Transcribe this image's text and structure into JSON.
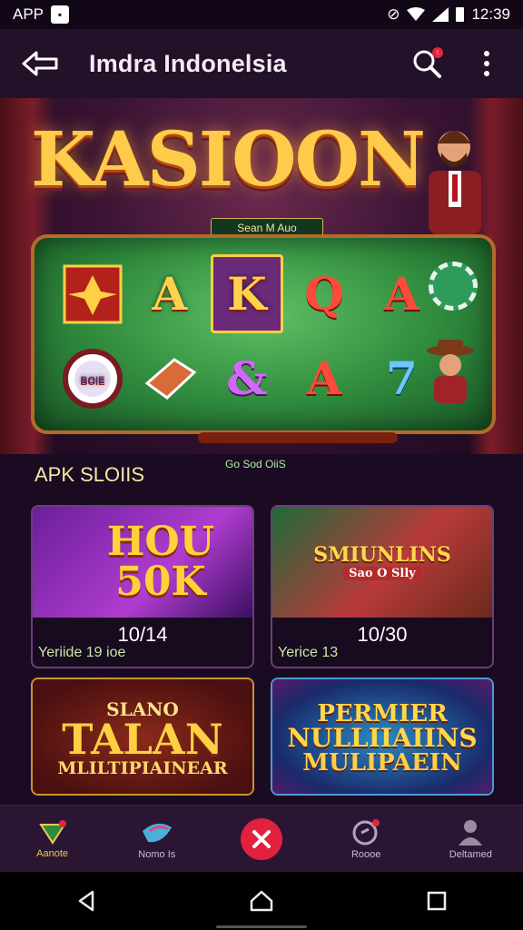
{
  "status_bar": {
    "app_label": "APP",
    "time": "12:39"
  },
  "app_bar": {
    "title": "Imdra Indonelsia",
    "notification_badge": "!"
  },
  "hero": {
    "title": "KASIOON",
    "sub_banner": "Sean M Auo",
    "slot_symbols": [
      "",
      "A",
      "K",
      "Q",
      "A",
      "",
      "",
      "&",
      "A",
      "7"
    ],
    "chip_label": "BOIE"
  },
  "section": {
    "label": "APK SLOIIS",
    "small_text": "Go Sod OiiS"
  },
  "cards": [
    {
      "art_title": "HOU 50K",
      "count": "10/14",
      "version": "Yeriide 19 ioe"
    },
    {
      "art_title": "SMIUNLINS",
      "art_subtitle": "Sao O Slly",
      "count": "10/30",
      "version": "Yerice 13"
    },
    {
      "art_title_top": "SLANO",
      "art_title": "TALAN",
      "art_subtitle": "MLILTIPIAINEAR"
    },
    {
      "art_title_top": "PERMIER",
      "art_title": "NULLIIAIINS",
      "art_subtitle": "MULIPAEIN"
    }
  ],
  "bottom_nav": [
    {
      "label": "Aanote",
      "icon": "gift-icon",
      "active": true
    },
    {
      "label": "Nomo Is",
      "icon": "bird-icon",
      "active": false
    },
    {
      "label": "",
      "icon": "close-icon",
      "active": false
    },
    {
      "label": "Roooe",
      "icon": "circle-icon",
      "active": false
    },
    {
      "label": "Deltamed",
      "icon": "user-icon",
      "active": false
    }
  ],
  "card_extra_text": "10/30",
  "colors": {
    "background": "#1a0a22",
    "accent_gold": "#ffcb4a",
    "fab_red": "#e2213e",
    "slot_green": "#2f8a3d"
  }
}
